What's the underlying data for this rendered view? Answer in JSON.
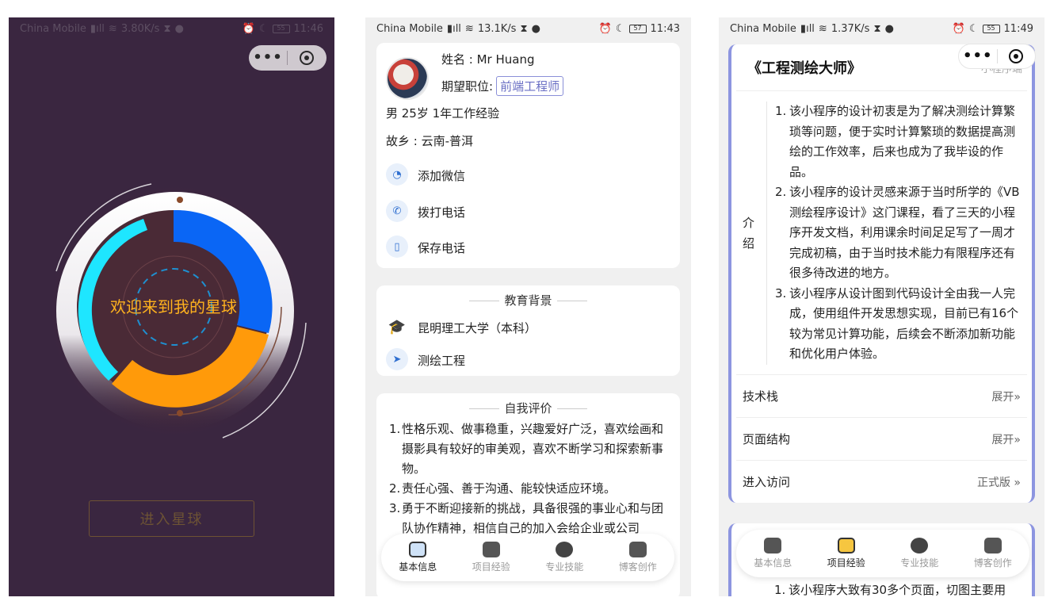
{
  "status": {
    "p1": {
      "carrier": "China Mobile",
      "speed": "3.80K/s",
      "battery": "55",
      "time": "11:46"
    },
    "p2": {
      "carrier": "China Mobile",
      "speed": "13.1K/s",
      "battery": "57",
      "time": "11:43"
    },
    "p3": {
      "carrier": "China Mobile",
      "speed": "1.37K/s",
      "battery": "55",
      "time": "11:49"
    }
  },
  "welcome": {
    "title": "欢迎来到我的星球",
    "enter_button": "进入星球",
    "colors": {
      "bg": "#3a2640",
      "blue": "#0a66f5",
      "orange": "#ff9a0a",
      "cyan": "#1ee6ff"
    }
  },
  "profile": {
    "name_label": "姓名 : Mr Huang",
    "job_label": "期望职位:",
    "job_tag": "前端工程师",
    "meta": "男 25岁 1年工作经验",
    "hometown": "故乡 : 云南-普洱",
    "actions": [
      {
        "icon": "wechat-icon",
        "label": "添加微信"
      },
      {
        "icon": "phone-icon",
        "label": "拨打电话"
      },
      {
        "icon": "mobile-icon",
        "label": "保存电话"
      }
    ],
    "education": {
      "title": "教育背景",
      "items": [
        {
          "icon": "graduation-cap-icon",
          "label": "昆明理工大学（本科）"
        },
        {
          "icon": "send-icon",
          "label": "测绘工程"
        }
      ]
    },
    "self_eval": {
      "title": "自我评价",
      "items": [
        "性格乐观、做事稳重，兴趣爱好广泛，喜欢绘画和摄影具有较好的审美观，喜欢不断学习和探索新事物。",
        "责任心强、善于沟通、能较快适应环境。",
        "勇于不断迎接新的挑战，具备很强的事业心和与团队协作精神，相信自己的加入会给企业或公司"
      ]
    }
  },
  "tabs": {
    "items": [
      "基本信息",
      "项目经验",
      "专业技能",
      "博客创作"
    ]
  },
  "project": {
    "title": "《工程测绘大师》",
    "mini": "小程序端",
    "intro_label": "介绍",
    "intro": [
      "该小程序的设计初衷是为了解决测绘计算繁琐等问题，便于实时计算繁琐的数据提高测绘的工作效率，后来也成为了我毕设的作品。",
      "该小程序的设计灵感来源于当时所学的《VB测绘程序设计》这门课程，看了三天的小程序开发文档，利用课余时间足足写了一周才完成初稿，由于当时技术能力有限程序还有很多待改进的地方。",
      "该小程序从设计图到代码设计全由我一人完成，使用组件开发思想实现，目前已有16个较为常见计算功能，后续会不断添加新功能和优化用户体验。"
    ],
    "rows": [
      {
        "label": "技术栈",
        "value": "展开»"
      },
      {
        "label": "页面结构",
        "value": "展开»"
      },
      {
        "label": "进入访问",
        "value": "正式版 »"
      }
    ],
    "next_intro_peek": "该小程序大致有30多个页面，切图主要用"
  }
}
